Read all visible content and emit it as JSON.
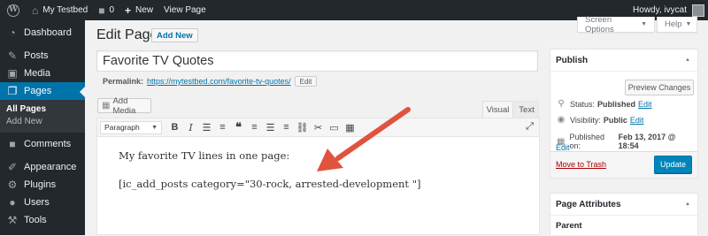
{
  "adminbar": {
    "site_name": "My Testbed",
    "comments_count": "0",
    "new_label": "New",
    "view_page_label": "View Page",
    "howdy": "Howdy, ivycat"
  },
  "sidebar": {
    "items": [
      {
        "label": "Dashboard",
        "icon": "dashboard-icon"
      },
      {
        "label": "Posts",
        "icon": "pin-icon"
      },
      {
        "label": "Media",
        "icon": "media-icon"
      },
      {
        "label": "Pages",
        "icon": "pages-icon"
      },
      {
        "label": "Comments",
        "icon": "comment-icon"
      },
      {
        "label": "Appearance",
        "icon": "brush-icon"
      },
      {
        "label": "Plugins",
        "icon": "plugin-icon"
      },
      {
        "label": "Users",
        "icon": "users-icon"
      },
      {
        "label": "Tools",
        "icon": "wrench-icon"
      }
    ],
    "submenu": [
      "All Pages",
      "Add New"
    ]
  },
  "header": {
    "title": "Edit Page",
    "add_new": "Add New",
    "screen_options": "Screen Options",
    "help": "Help"
  },
  "editor": {
    "title_value": "Favorite TV Quotes",
    "permalink_label": "Permalink:",
    "permalink_url": "https://mytestbed.com/favorite-tv-quotes/",
    "permalink_edit": "Edit",
    "add_media": "Add Media",
    "tab_visual": "Visual",
    "tab_text": "Text",
    "format_value": "Paragraph",
    "content_line1": "My favorite TV lines in one page:",
    "content_line2": "[ic_add_posts category=\"30-rock, arrested-development \"]"
  },
  "publish": {
    "heading": "Publish",
    "preview_button": "Preview Changes",
    "status_label": "Status:",
    "status_value": "Published",
    "status_edit": "Edit",
    "visibility_label": "Visibility:",
    "visibility_value": "Public",
    "visibility_edit": "Edit",
    "published_label": "Published on:",
    "published_value": "Feb 13, 2017 @ 18:54",
    "published_edit": "Edit",
    "trash": "Move to Trash",
    "update": "Update"
  },
  "page_attributes": {
    "heading": "Page Attributes",
    "parent_label": "Parent"
  },
  "colors": {
    "admin_dark": "#23282d",
    "accent_blue": "#0073aa",
    "button_blue": "#0085ba",
    "arrow_red": "#e0533f",
    "trash_red": "#a00"
  }
}
